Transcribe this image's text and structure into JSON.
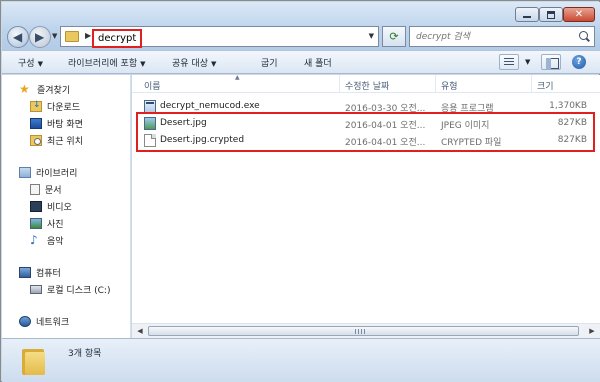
{
  "window": {
    "minimize_label": "—",
    "close_label": "✕"
  },
  "address": {
    "breadcrumb": "decrypt",
    "search_placeholder": "decrypt 검색"
  },
  "toolbar": {
    "organize": "구성",
    "include_library": "라이브러리에 포함",
    "share_with": "공유 대상",
    "burn": "굽기",
    "new_folder": "새 폴더"
  },
  "nav": {
    "favorites": "즐겨찾기",
    "downloads": "다운로드",
    "desktop": "바탕 화면",
    "recent": "최근 위치",
    "libraries": "라이브러리",
    "documents": "문서",
    "videos": "비디오",
    "pictures": "사진",
    "music": "음악",
    "computer": "컴퓨터",
    "local_disk": "로컬 디스크 (C:)",
    "network": "네트워크"
  },
  "columns": {
    "name": "이름",
    "date": "수정한 날짜",
    "type": "유형",
    "size": "크기"
  },
  "files": [
    {
      "name": "decrypt_nemucod.exe",
      "date": "2016-03-30 오전...",
      "type": "응용 프로그램",
      "size": "1,370KB",
      "icon": "exe-icon"
    },
    {
      "name": "Desert.jpg",
      "date": "2016-04-01 오전...",
      "type": "JPEG 이미지",
      "size": "827KB",
      "icon": "jpeg-icon"
    },
    {
      "name": "Desert.jpg.crypted",
      "date": "2016-04-01 오전...",
      "type": "CRYPTED 파일",
      "size": "827KB",
      "icon": "blank-file-icon"
    }
  ],
  "status": {
    "item_count": "3개 항목"
  },
  "colors": {
    "highlight_box": "#e0201f",
    "window_chrome": "#c9d9ea"
  }
}
